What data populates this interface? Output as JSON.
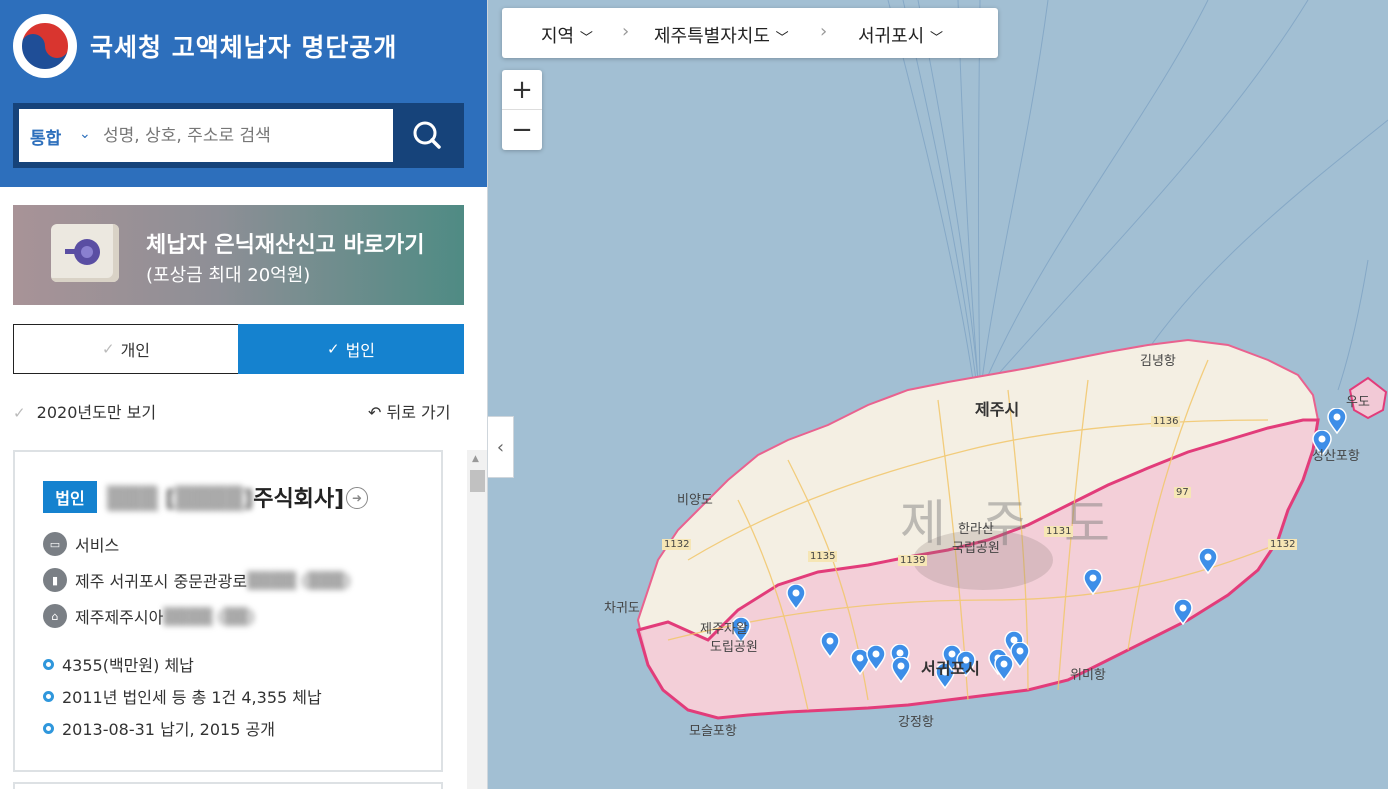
{
  "header": {
    "title": "국세청 고액체납자 명단공개"
  },
  "search": {
    "scope": "통합",
    "placeholder": "성명, 상호, 주소로 검색"
  },
  "banner": {
    "title": "체납자 은닉재산신고 바로가기",
    "subtitle": "(포상금 최대 20억원)"
  },
  "toggle": {
    "personal": "개인",
    "corporate": "법인",
    "selected": "법인"
  },
  "filters": {
    "year_only": "2020년도만 보기",
    "back": "뒤로 가기"
  },
  "card": {
    "badge": "법인",
    "name_redacted": "▒▒▒ [▒▒▒▒]",
    "name_suffix": "주식회사]",
    "industry": "서비스",
    "address": "제주 서귀포시 중문관광로",
    "address_redacted": "▒▒▒▒ (▒▒▒)",
    "home_address": "제주제주시아",
    "home_address_redacted": "▒▒▒▒ (▒▒)",
    "amount": "4355(백만원) 체납",
    "tax_detail": "2011년 법인세 등 총 1건 4,355 체납",
    "dates": "2013-08-31 납기, 2015 공개"
  },
  "breadcrumb": {
    "level1": "지역",
    "level2": "제주특별자치도",
    "level3": "서귀포시"
  },
  "zoom": {
    "in": "+",
    "out": "−"
  },
  "map_labels": {
    "jeju_si": "제주시",
    "seogwipo_si": "서귀포시",
    "jeju_do": "제주도",
    "hallasan": "한라산",
    "national_park": "국립공원",
    "gimnyeong": "김녕항",
    "udo": "우도",
    "seongsanpo": "성산포항",
    "biyangdo": "비양도",
    "chagwido": "차귀도",
    "forest": "제주자왈",
    "forest2": "도립공원",
    "wimi": "위미항",
    "gangjeong": "강정항",
    "moseulpo": "모슬포항",
    "route_1136": "1136",
    "route_1132a": "1132",
    "route_1132b": "1132",
    "route_1135": "1135",
    "route_1131": "1131",
    "route_97": "97",
    "route_1139": "1139"
  },
  "colors": {
    "header_blue": "#2d6fbc",
    "accent_blue": "#1582cf",
    "search_dark": "#16437a",
    "map_water": "#a2bfd3",
    "region_highlight": "#e23c7a"
  },
  "icons": {
    "search": "search-icon",
    "logo": "taegeuk-logo-icon",
    "safe": "safe-icon",
    "marker": "map-marker-icon"
  }
}
